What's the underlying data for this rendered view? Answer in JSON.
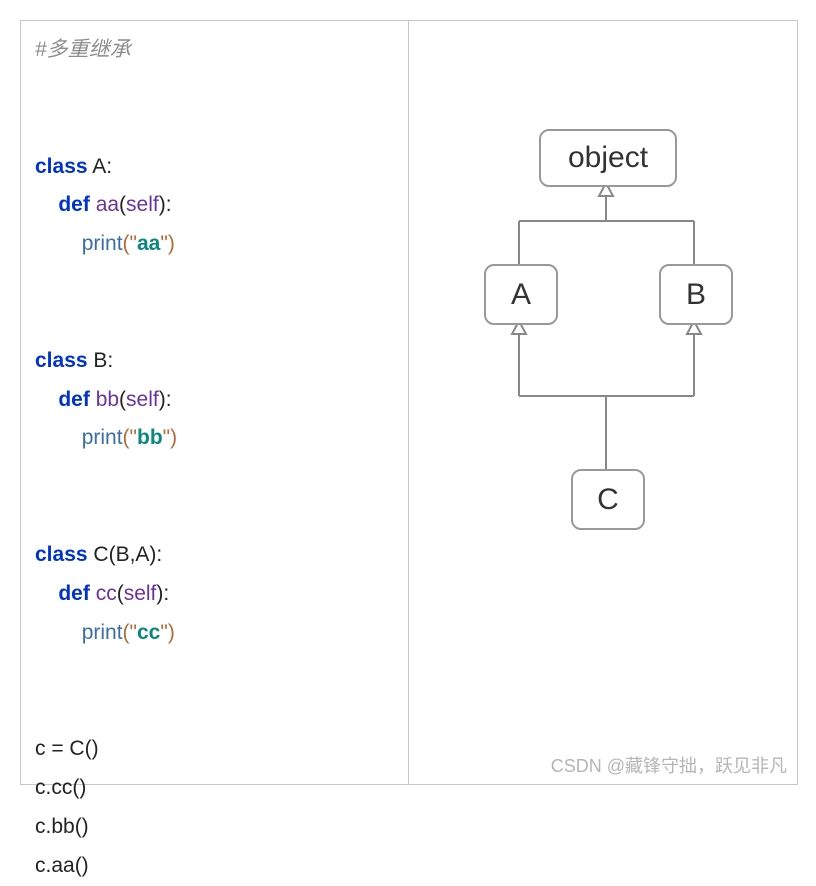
{
  "code": {
    "comment": "#多重继承",
    "classA": {
      "kw": "class",
      "name": "A",
      "colon": ":"
    },
    "defA": {
      "kw": "def",
      "name": "aa",
      "params": "self",
      "colon": ":"
    },
    "printA": {
      "fn": "print",
      "open": "(\"",
      "str": "aa",
      "close": "\")"
    },
    "classB": {
      "kw": "class",
      "name": "B",
      "colon": ":"
    },
    "defB": {
      "kw": "def",
      "name": "bb",
      "params": "self",
      "colon": ":"
    },
    "printB": {
      "fn": "print",
      "open": "(\"",
      "str": "bb",
      "close": "\")"
    },
    "classC": {
      "kw": "class",
      "name": "C",
      "bases": "(B,A)",
      "colon": ":"
    },
    "defC": {
      "kw": "def",
      "name": "cc",
      "params": "self",
      "colon": ":"
    },
    "printC": {
      "fn": "print",
      "open": "(\"",
      "str": "cc",
      "close": "\")"
    },
    "inst": "c = C()",
    "call1": "c.cc()",
    "call2": "c.bb()",
    "call3": "c.aa()"
  },
  "diagram": {
    "object": "object",
    "A": "A",
    "B": "B",
    "C": "C"
  },
  "watermark": "CSDN @藏锋守拙，跃见非凡"
}
